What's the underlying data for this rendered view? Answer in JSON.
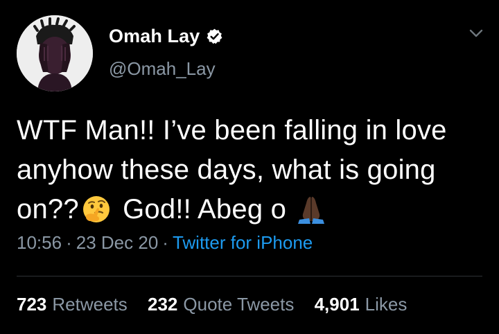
{
  "author": {
    "display_name": "Omah Lay",
    "handle": "@Omah_Lay",
    "verified": true
  },
  "tweet": {
    "line1": "WTF Man!! I’ve been falling in love",
    "line2": "anyhow these days, what is going",
    "line3_a": "on??",
    "emoji_1": "thinking-face-emoji",
    "line3_b": " God!! Abeg o ",
    "emoji_2": "folded-hands-emoji"
  },
  "meta": {
    "time": "10:56",
    "date": "23 Dec 20",
    "separator": "·",
    "source": "Twitter for iPhone"
  },
  "stats": [
    {
      "count": "723",
      "label": "Retweets"
    },
    {
      "count": "232",
      "label": "Quote Tweets"
    },
    {
      "count": "4,901",
      "label": "Likes"
    }
  ],
  "colors": {
    "background": "#000000",
    "text": "#ffffff",
    "secondary": "#8b98a5",
    "link": "#1d9bf0",
    "divider": "#2f3336"
  },
  "icons": {
    "verified": "verified-badge-icon",
    "caret": "chevron-down-icon"
  }
}
